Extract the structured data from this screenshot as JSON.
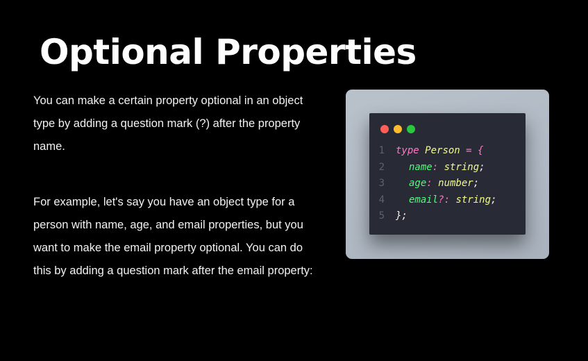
{
  "slide": {
    "title": "Optional Properties",
    "paragraph_1": "You can make a certain property optional in an object type by adding a question mark (?) after the property name.",
    "paragraph_2": "For example, let's say you have an object type for a person with name, age, and email properties, but you want to make the email property optional. You can do this by adding a question mark after the email property:"
  },
  "code_window": {
    "dots": [
      "#ff5f57",
      "#febc2e",
      "#28c840"
    ],
    "lines": [
      {
        "num": "1",
        "indent": false,
        "tokens": [
          {
            "text": "type ",
            "color": "#ff79c6"
          },
          {
            "text": "Person ",
            "color": "#f1fa8c"
          },
          {
            "text": "= {",
            "color": "#ff79c6"
          }
        ]
      },
      {
        "num": "2",
        "indent": true,
        "tokens": [
          {
            "text": "name",
            "color": "#50fa7b"
          },
          {
            "text": ": ",
            "color": "#ff79c6"
          },
          {
            "text": "string",
            "color": "#f1fa8c"
          },
          {
            "text": ";",
            "color": "#f8f8f2"
          }
        ]
      },
      {
        "num": "3",
        "indent": true,
        "tokens": [
          {
            "text": "age",
            "color": "#50fa7b"
          },
          {
            "text": ": ",
            "color": "#ff79c6"
          },
          {
            "text": "number",
            "color": "#f1fa8c"
          },
          {
            "text": ";",
            "color": "#f8f8f2"
          }
        ]
      },
      {
        "num": "4",
        "indent": true,
        "tokens": [
          {
            "text": "email",
            "color": "#50fa7b"
          },
          {
            "text": "?: ",
            "color": "#ff79c6"
          },
          {
            "text": "string",
            "color": "#f1fa8c"
          },
          {
            "text": ";",
            "color": "#f8f8f2"
          }
        ]
      },
      {
        "num": "5",
        "indent": false,
        "tokens": [
          {
            "text": "};",
            "color": "#f8f8f2"
          }
        ]
      }
    ]
  }
}
